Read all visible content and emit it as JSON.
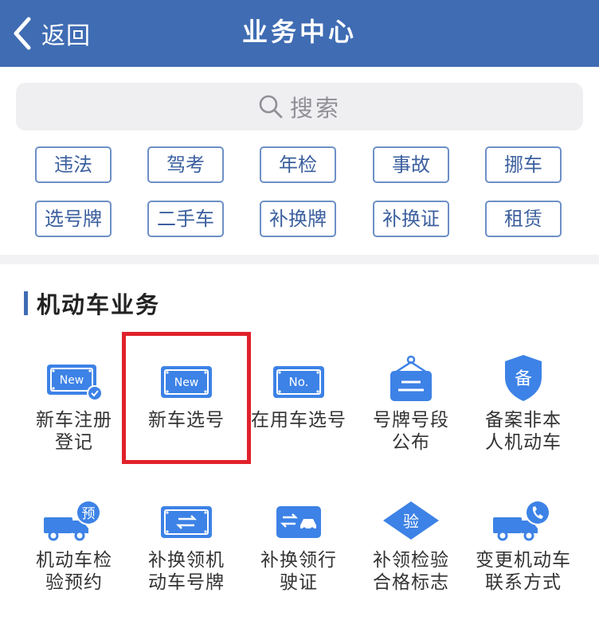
{
  "header": {
    "back_label": "返回",
    "title": "业务中心"
  },
  "search": {
    "placeholder": "搜索"
  },
  "tags": [
    "违法",
    "驾考",
    "年检",
    "事故",
    "挪车",
    "选号牌",
    "二手车",
    "补换牌",
    "补换证",
    "租赁"
  ],
  "section": {
    "title": "机动车业务"
  },
  "services": [
    {
      "label": "新车注册\n登记",
      "icon": "new-plate-check-icon",
      "badge": "New"
    },
    {
      "label": "新车选号",
      "icon": "new-plate-icon",
      "badge": "New"
    },
    {
      "label": "在用车选号",
      "icon": "number-plate-icon",
      "badge": "No."
    },
    {
      "label": "号牌号段\n公布",
      "icon": "hanging-sign-icon"
    },
    {
      "label": "备案非本\n人机动车",
      "icon": "shield-icon",
      "badge": "备"
    },
    {
      "label": "机动车检\n验预约",
      "icon": "truck-appointment-icon",
      "badge": "预"
    },
    {
      "label": "补换领机\n动车号牌",
      "icon": "plate-exchange-icon"
    },
    {
      "label": "补换领行\n驶证",
      "icon": "license-exchange-icon"
    },
    {
      "label": "补领检验\n合格标志",
      "icon": "inspection-badge-icon",
      "badge": "验"
    },
    {
      "label": "变更机动车\n联系方式",
      "icon": "truck-phone-icon"
    }
  ],
  "colors": {
    "header": "#3F6CB3",
    "icon": "#3d82e6",
    "highlight": "#e0212b"
  }
}
